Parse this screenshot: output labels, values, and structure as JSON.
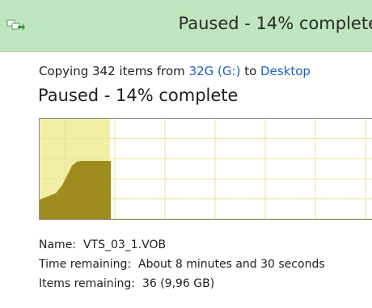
{
  "title_bar": {
    "title": "Paused - 14% complete"
  },
  "copy_info": {
    "prefix": "Copying 342 items from ",
    "source": "32G (G:)",
    "middle": " to ",
    "destination": "Desktop"
  },
  "status": {
    "heading": "Paused - 14% complete",
    "progress_percent": 14
  },
  "details": {
    "name_label": "Name:",
    "name_value": "VTS_03_1.VOB",
    "time_label": "Time remaining:",
    "time_value": "About 8 minutes and 30 seconds",
    "items_label": "Items remaining:",
    "items_value": "36 (9,96 GB)"
  },
  "colors": {
    "titlebar": "#bfe6bf",
    "graph_fill_done": "#f2eea6",
    "graph_speed": "#a08c1e",
    "graph_grid": "#e9e39a",
    "link": "#1f5fbf"
  },
  "icons": [
    "file-copy-icon"
  ]
}
